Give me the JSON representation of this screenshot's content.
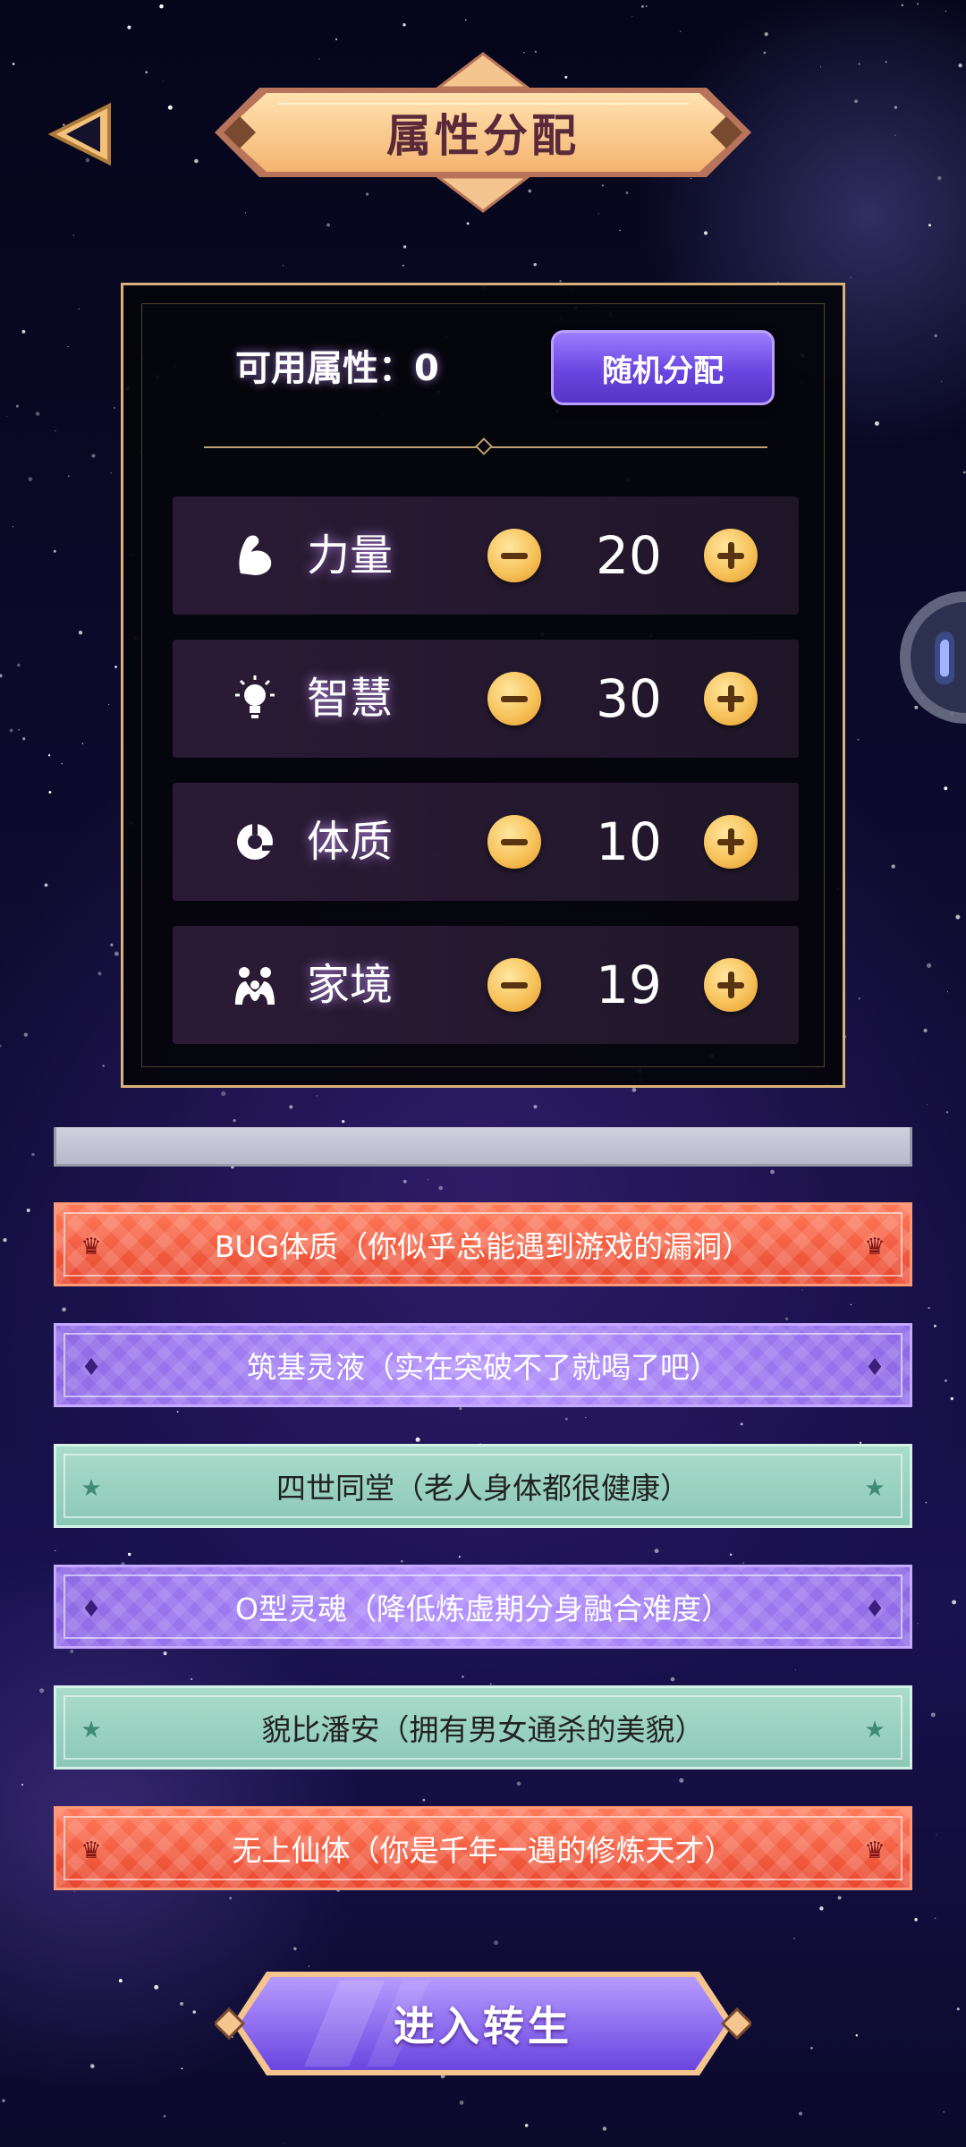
{
  "header": {
    "title": "属性分配"
  },
  "panel": {
    "available_label": "可用属性：",
    "available_value": "0",
    "random_button": "随机分配"
  },
  "stats": [
    {
      "label": "力量",
      "value": "20",
      "icon": "muscle-icon"
    },
    {
      "label": "智慧",
      "value": "30",
      "icon": "lightbulb-icon"
    },
    {
      "label": "体质",
      "value": "10",
      "icon": "constitution-icon"
    },
    {
      "label": "家境",
      "value": "19",
      "icon": "family-icon"
    }
  ],
  "talents": [
    {
      "text": "BUG体质（你似乎总能遇到游戏的漏洞）",
      "style": "red",
      "icon": "crown-icon"
    },
    {
      "text": "筑基灵液（实在突破不了就喝了吧）",
      "style": "purple",
      "icon": "diamond-icon"
    },
    {
      "text": "四世同堂（老人身体都很健康）",
      "style": "green",
      "icon": "star-icon"
    },
    {
      "text": "O型灵魂（降低炼虚期分身融合难度）",
      "style": "purple",
      "icon": "diamond-icon"
    },
    {
      "text": "貌比潘安（拥有男女通杀的美貌）",
      "style": "green",
      "icon": "star-icon"
    },
    {
      "text": "无上仙体（你是千年一遇的修炼天才）",
      "style": "red",
      "icon": "crown-icon"
    }
  ],
  "footer": {
    "enter_button": "进入转生"
  },
  "colors": {
    "gold": "#f7c25a",
    "purple": "#7c5cf0",
    "red": "#e8472e",
    "green": "#8cc8b6"
  }
}
